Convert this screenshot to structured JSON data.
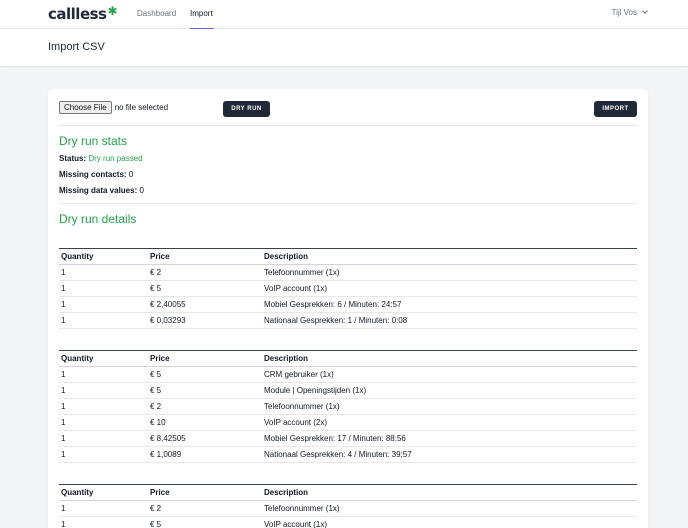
{
  "nav": {
    "logo": "callless",
    "links": [
      {
        "label": "Dashboard"
      },
      {
        "label": "Import"
      }
    ],
    "user": "Tijl Vos"
  },
  "header": {
    "title": "Import CSV"
  },
  "upload": {
    "choose_label": "Choose File",
    "file_status": "no file selected",
    "dry_run_label": "DRY RUN",
    "import_label": "IMPORT"
  },
  "stats": {
    "title": "Dry run stats",
    "status_label": "Status:",
    "status_value": "Dry run passed",
    "missing_contacts_label": "Missing contacts:",
    "missing_contacts_value": "0",
    "missing_data_label": "Missing data values:",
    "missing_data_value": "0"
  },
  "details": {
    "title": "Dry run details",
    "columns": [
      "Quantity",
      "Price",
      "Description"
    ],
    "tables": [
      {
        "rows": [
          [
            "1",
            "€ 2",
            "Telefoonnummer (1x)"
          ],
          [
            "1",
            "€ 5",
            "VoIP account (1x)"
          ],
          [
            "1",
            "€ 2,40055",
            "Mobiel Gesprekken: 6 / Minuten: 24:57"
          ],
          [
            "1",
            "€ 0,03293",
            "Nationaal Gesprekken: 1 / Minuten: 0:08"
          ]
        ]
      },
      {
        "rows": [
          [
            "1",
            "€ 5",
            "CRM gebruiker (1x)"
          ],
          [
            "1",
            "€ 5",
            "Module | Openingstijden (1x)"
          ],
          [
            "1",
            "€ 2",
            "Telefoonnummer (1x)"
          ],
          [
            "1",
            "€ 10",
            "VoIP account (2x)"
          ],
          [
            "1",
            "€ 8,42505",
            "Mobiel Gesprekken: 17 / Minuten: 88:56"
          ],
          [
            "1",
            "€ 1,0089",
            "Nationaal Gesprekken: 4 / Minuten: 39:57"
          ]
        ]
      },
      {
        "rows": [
          [
            "1",
            "€ 2",
            "Telefoonnummer (1x)"
          ],
          [
            "1",
            "€ 5",
            "VoIP account (1x)"
          ]
        ]
      }
    ]
  }
}
